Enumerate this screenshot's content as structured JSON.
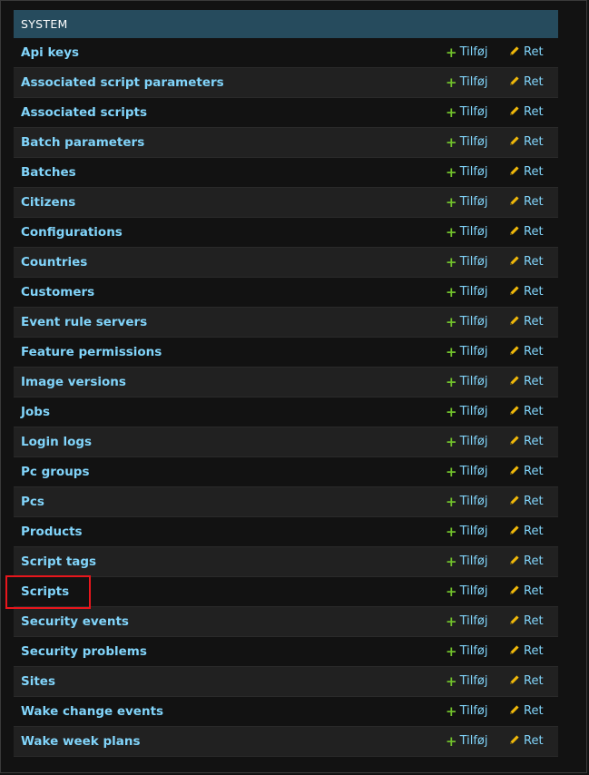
{
  "module": {
    "caption": "SYSTEM",
    "add_label": "Tilføj",
    "change_label": "Ret",
    "add_icon": "plus-icon",
    "change_icon": "pencil-icon",
    "colors": {
      "caption_bg": "#264b5d",
      "link": "#81d4fa",
      "add_icon": "#70bf2b",
      "change_icon": "#efb80b",
      "highlight": "#e8161c"
    },
    "models": [
      "Api keys",
      "Associated script parameters",
      "Associated scripts",
      "Batch parameters",
      "Batches",
      "Citizens",
      "Configurations",
      "Countries",
      "Customers",
      "Event rule servers",
      "Feature permissions",
      "Image versions",
      "Jobs",
      "Login logs",
      "Pc groups",
      "Pcs",
      "Products",
      "Script tags",
      "Scripts",
      "Security events",
      "Security problems",
      "Sites",
      "Wake change events",
      "Wake week plans"
    ],
    "highlighted_model": "Scripts"
  }
}
